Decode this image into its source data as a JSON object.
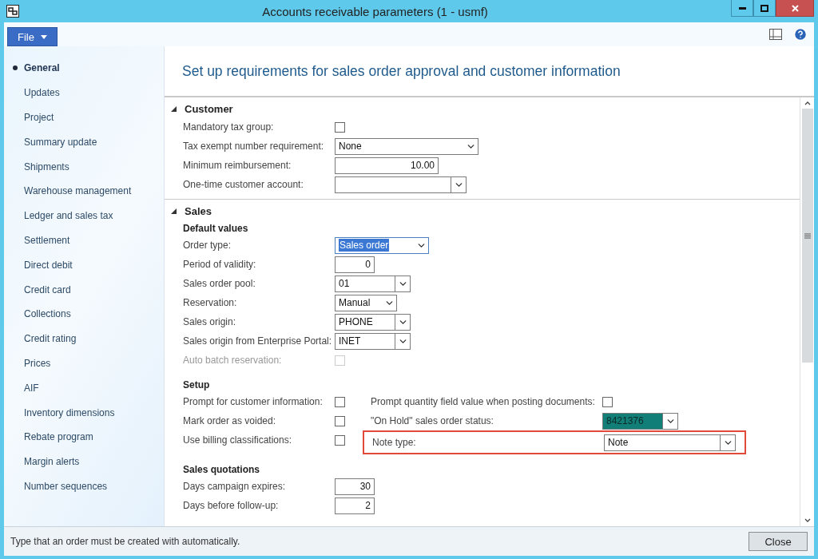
{
  "window": {
    "title": "Accounts receivable parameters (1 - usmf)"
  },
  "menu": {
    "file_button": "File"
  },
  "sidebar": {
    "items": [
      {
        "label": "General",
        "selected": true
      },
      {
        "label": "Updates",
        "selected": false
      },
      {
        "label": "Project",
        "selected": false
      },
      {
        "label": "Summary update",
        "selected": false
      },
      {
        "label": "Shipments",
        "selected": false
      },
      {
        "label": "Warehouse management",
        "selected": false
      },
      {
        "label": "Ledger and sales tax",
        "selected": false
      },
      {
        "label": "Settlement",
        "selected": false
      },
      {
        "label": "Direct debit",
        "selected": false
      },
      {
        "label": "Credit card",
        "selected": false
      },
      {
        "label": "Collections",
        "selected": false
      },
      {
        "label": "Credit rating",
        "selected": false
      },
      {
        "label": "Prices",
        "selected": false
      },
      {
        "label": "AIF",
        "selected": false
      },
      {
        "label": "Inventory dimensions",
        "selected": false
      },
      {
        "label": "Rebate program",
        "selected": false
      },
      {
        "label": "Margin alerts",
        "selected": false
      },
      {
        "label": "Number sequences",
        "selected": false
      }
    ]
  },
  "heading": "Set up requirements for sales order approval and customer information",
  "sections": [
    {
      "title": "Customer",
      "expanded": true,
      "groups": [
        {
          "columns": [
            [
              {
                "kind": "checkbox",
                "label": "Mandatory tax group:",
                "checked": false,
                "disabled": false
              },
              {
                "kind": "dropdown",
                "label": "Tax exempt number requirement:",
                "value": "None",
                "selected": false
              },
              {
                "kind": "number",
                "label": "Minimum reimbursement:",
                "value": "10.00"
              },
              {
                "kind": "lookup",
                "label": "One-time customer account:"
              }
            ]
          ]
        }
      ]
    },
    {
      "title": "Sales",
      "expanded": true,
      "groups": [
        {
          "title": "Default values",
          "columns": [
            [
              {
                "kind": "dropdown",
                "label": "Order type:",
                "value": "Sales order",
                "selected": true
              },
              {
                "kind": "number",
                "label": "Period of validity:",
                "value": "0"
              },
              {
                "kind": "lookup",
                "label": "Sales order pool:",
                "value": "01"
              },
              {
                "kind": "dropdown",
                "label": "Reservation:",
                "value": "Manual",
                "selected": false
              },
              {
                "kind": "lookup",
                "label": "Sales origin:",
                "value": "PHONE"
              },
              {
                "kind": "lookup",
                "label": "Sales origin from Enterprise Portal:",
                "value": "INET"
              },
              {
                "kind": "checkbox",
                "label": "Auto batch reservation:",
                "checked": false,
                "disabled": true
              }
            ]
          ]
        },
        {
          "title": "Setup",
          "columns": [
            [
              {
                "kind": "checkbox",
                "label": "Prompt for customer information:",
                "checked": false,
                "disabled": false
              },
              {
                "kind": "checkbox",
                "label": "Mark order as voided:",
                "checked": false,
                "disabled": false
              },
              {
                "kind": "checkbox",
                "label": "Use billing classifications:",
                "checked": false,
                "disabled": false
              }
            ],
            [
              {
                "kind": "checkbox",
                "label": "Prompt quantity field value when posting documents:",
                "checked": false,
                "disabled": false
              },
              {
                "kind": "lookup",
                "label": "\"On Hold\" sales order status:",
                "value": "8421376",
                "color": "#127e78"
              },
              {
                "kind": "lookup",
                "label": "Note type:",
                "value": "Note",
                "highlighted": true
              }
            ]
          ]
        },
        {
          "title": "Sales quotations",
          "columns": [
            [
              {
                "kind": "number",
                "label": "Days campaign expires:",
                "value": "30"
              },
              {
                "kind": "number",
                "label": "Days before follow-up:",
                "value": "2"
              }
            ]
          ]
        }
      ]
    }
  ],
  "status_bar": {
    "text": "Type that an order must be created with automatically.",
    "close_button": "Close"
  }
}
